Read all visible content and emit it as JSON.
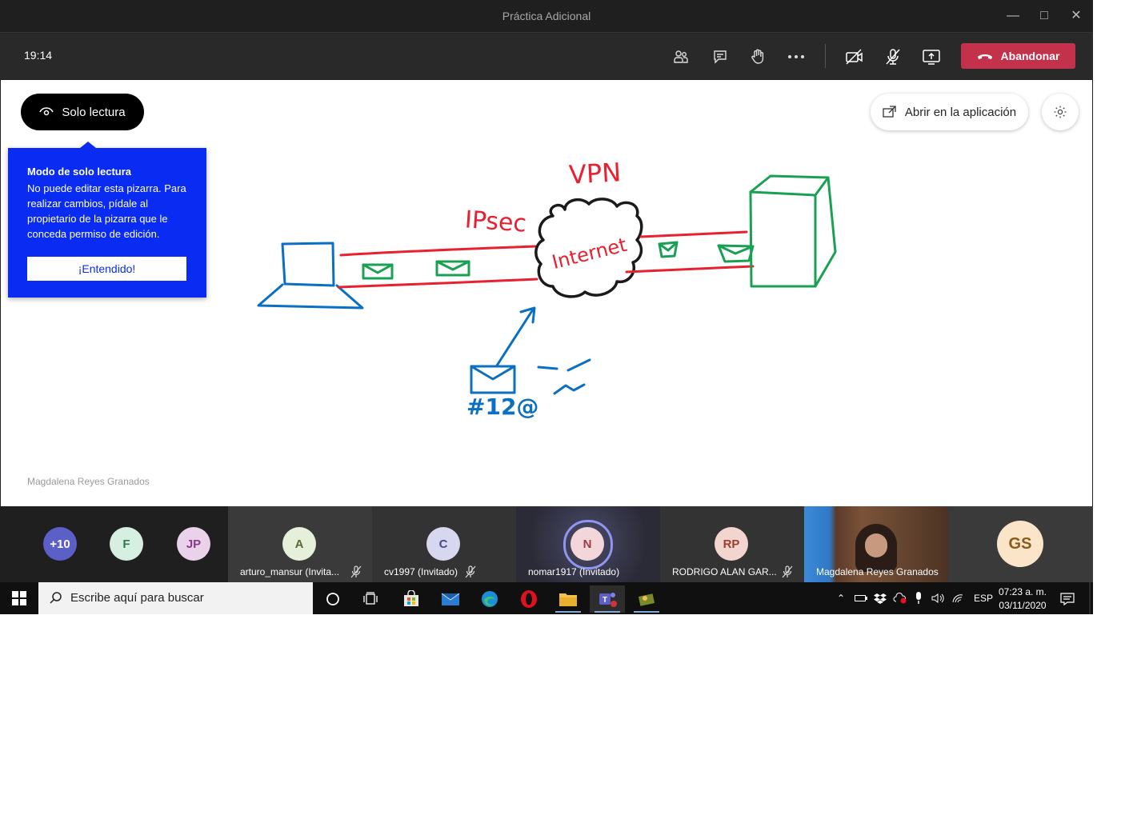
{
  "window": {
    "title": "Práctica Adicional"
  },
  "toolbar": {
    "time": "19:14",
    "leave_label": "Abandonar"
  },
  "whiteboard": {
    "readonly_label": "Solo lectura",
    "callout": {
      "title": "Modo de solo lectura",
      "body": "No puede editar esta pizarra. Para realizar cambios, pídale al propietario de la pizarra que le conceda permiso de edición.",
      "button": "¡Entendido!"
    },
    "open_app_label": "Abrir en la aplicación",
    "author": "Magdalena Reyes Granados",
    "ink": {
      "vpn": "VPN",
      "ipsec": "IPsec",
      "internet": "Internet",
      "address": "#12@"
    }
  },
  "participants": {
    "overflow": "+10",
    "small": [
      "F",
      "JP"
    ],
    "tiles": [
      {
        "initials": "A",
        "name": "arturo_mansur (Invita...",
        "muted": true
      },
      {
        "initials": "C",
        "name": "cv1997 (Invitado)",
        "muted": true
      },
      {
        "initials": "N",
        "name": "nomar1917 (Invitado)",
        "muted": false
      },
      {
        "initials": "RP",
        "name": "RODRIGO ALAN GAR...",
        "muted": true
      },
      {
        "initials": "",
        "name": "Magdalena Reyes Granados",
        "muted": false
      },
      {
        "initials": "GS",
        "name": "",
        "muted": false
      }
    ]
  },
  "taskbar": {
    "search_placeholder": "Escribe aquí para buscar",
    "language": "ESP",
    "time": "07:23 a. m.",
    "date": "03/11/2020"
  },
  "colors": {
    "leave": "#c4314b",
    "callout": "#0a2bf2",
    "ink_red": "#e8202f",
    "ink_blue": "#0b6fc2",
    "ink_green": "#1aa053",
    "ink_black": "#1a1a1a"
  }
}
